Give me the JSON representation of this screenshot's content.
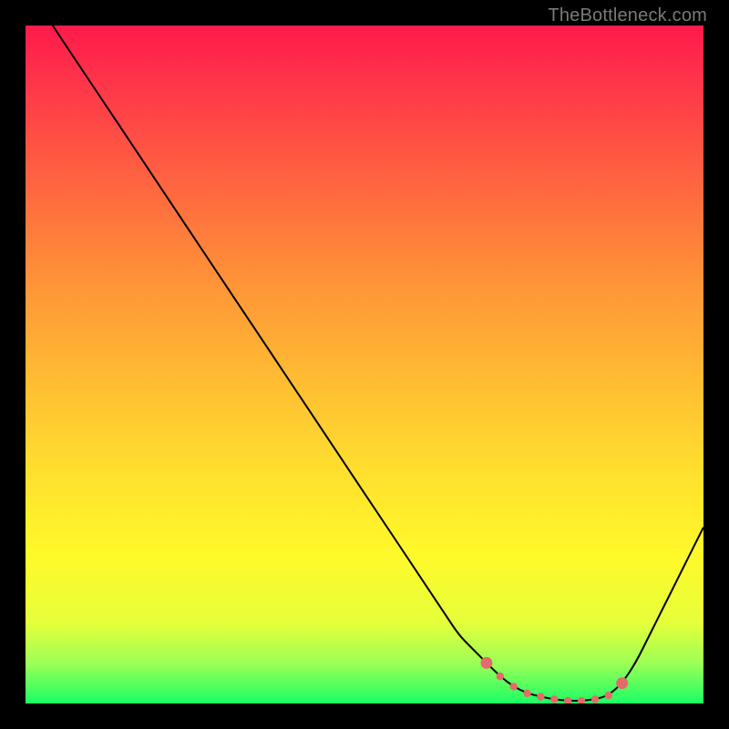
{
  "branding": "TheBottleneck.com",
  "chart_data": {
    "type": "line",
    "title": "",
    "xlabel": "",
    "ylabel": "",
    "xlim": [
      0,
      100
    ],
    "ylim": [
      0,
      100
    ],
    "series": [
      {
        "name": "bottleneck-curve",
        "x": [
          4,
          8,
          12,
          16,
          20,
          24,
          28,
          32,
          36,
          40,
          44,
          48,
          52,
          56,
          60,
          62,
          64,
          66,
          68,
          70,
          72,
          74,
          76,
          78,
          80,
          82,
          84,
          86,
          88,
          90,
          92,
          94,
          96,
          100
        ],
        "values": [
          100,
          94,
          88,
          82,
          76,
          70,
          64,
          58,
          52,
          46,
          40,
          34,
          28,
          22,
          16,
          13,
          10,
          8,
          6,
          4,
          2.5,
          1.5,
          1,
          0.6,
          0.4,
          0.4,
          0.6,
          1.2,
          3,
          6,
          10,
          14,
          18,
          26
        ]
      }
    ],
    "highlight_region": {
      "x_start": 68,
      "x_end": 88,
      "color": "#e56a6a",
      "label": "optimal-range-dots"
    },
    "gradient_stops": [
      {
        "pos": 0,
        "color": "#ff1a4b"
      },
      {
        "pos": 25,
        "color": "#ff6a3f"
      },
      {
        "pos": 52,
        "color": "#ffbb33"
      },
      {
        "pos": 78,
        "color": "#fff92a"
      },
      {
        "pos": 100,
        "color": "#1aff66"
      }
    ]
  }
}
